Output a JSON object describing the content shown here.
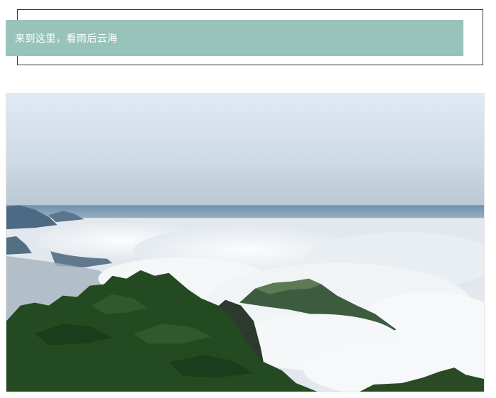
{
  "header": {
    "title": "来到这里，看雨后云海"
  },
  "photo": {
    "subject": "sea-of-clouds-landscape",
    "colors": {
      "sky_top": "#dbe8f3",
      "sky_bottom": "#c6d4df",
      "horizon_blue": "#6d8fab",
      "cloud": "#eef1f3",
      "pine": "#244a22",
      "mountain": "#3a5940",
      "banner": "#98c3bb"
    }
  }
}
